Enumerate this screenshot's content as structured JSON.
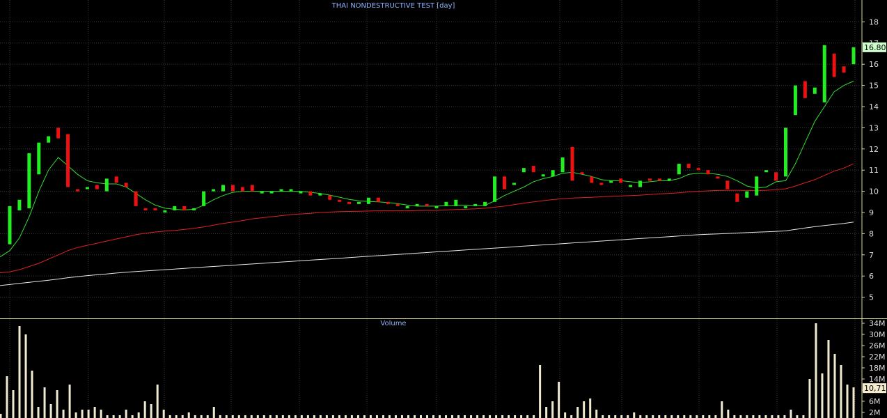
{
  "chart_data": [
    {
      "type": "candlestick",
      "title": "THAI NONDESTRUCTIVE TEST [day]",
      "ylim": [
        4,
        19
      ],
      "y_ticks": [
        "5",
        "6",
        "7",
        "8",
        "9",
        "10",
        "11",
        "12",
        "13",
        "14",
        "15",
        "16",
        "17",
        "18"
      ],
      "last_price_label": "16.80",
      "colors": {
        "up": "#22ee22",
        "down": "#ee1111",
        "ma_short": "#33dd33",
        "ma_mid": "#dd2222",
        "ma_long": "#e8e8e8",
        "grid": "#3a3a3a",
        "axis_text": "#dddddd",
        "price_tag": "#ccffcc"
      },
      "candles": [
        {
          "o": 7.5,
          "c": 9.3
        },
        {
          "o": 9.1,
          "c": 9.6
        },
        {
          "o": 9.2,
          "c": 11.8
        },
        {
          "o": 10.8,
          "c": 12.3
        },
        {
          "o": 12.3,
          "c": 12.6
        },
        {
          "o": 13.0,
          "c": 12.5
        },
        {
          "o": 12.7,
          "c": 10.2
        },
        {
          "o": 10.1,
          "c": 10.0
        },
        {
          "o": 10.1,
          "c": 10.2
        },
        {
          "o": 10.3,
          "c": 10.1
        },
        {
          "o": 10.0,
          "c": 10.6
        },
        {
          "o": 10.7,
          "c": 10.4
        },
        {
          "o": 10.4,
          "c": 10.2
        },
        {
          "o": 10.0,
          "c": 9.3
        },
        {
          "o": 9.2,
          "c": 9.1
        },
        {
          "o": 9.2,
          "c": 9.1
        },
        {
          "o": 9.1,
          "c": 9.1
        },
        {
          "o": 9.1,
          "c": 9.3
        },
        {
          "o": 9.3,
          "c": 9.1
        },
        {
          "o": 9.1,
          "c": 9.2
        },
        {
          "o": 9.3,
          "c": 10.0
        },
        {
          "o": 10.0,
          "c": 10.1
        },
        {
          "o": 10.0,
          "c": 10.3
        },
        {
          "o": 10.3,
          "c": 10.0
        },
        {
          "o": 10.2,
          "c": 10.0
        },
        {
          "o": 10.3,
          "c": 10.0
        },
        {
          "o": 10.0,
          "c": 10.0
        },
        {
          "o": 10.0,
          "c": 10.0
        },
        {
          "o": 10.0,
          "c": 10.1
        },
        {
          "o": 10.0,
          "c": 10.1
        },
        {
          "o": 10.0,
          "c": 10.0
        },
        {
          "o": 10.0,
          "c": 9.8
        },
        {
          "o": 9.9,
          "c": 9.9
        },
        {
          "o": 9.8,
          "c": 9.6
        },
        {
          "o": 9.6,
          "c": 9.5
        },
        {
          "o": 9.5,
          "c": 9.4
        },
        {
          "o": 9.4,
          "c": 9.5
        },
        {
          "o": 9.4,
          "c": 9.7
        },
        {
          "o": 9.7,
          "c": 9.5
        },
        {
          "o": 9.5,
          "c": 9.4
        },
        {
          "o": 9.4,
          "c": 9.3
        },
        {
          "o": 9.2,
          "c": 9.3
        },
        {
          "o": 9.3,
          "c": 9.4
        },
        {
          "o": 9.4,
          "c": 9.3
        },
        {
          "o": 9.3,
          "c": 9.3
        },
        {
          "o": 9.3,
          "c": 9.5
        },
        {
          "o": 9.3,
          "c": 9.6
        },
        {
          "o": 9.3,
          "c": 9.3
        },
        {
          "o": 9.3,
          "c": 9.4
        },
        {
          "o": 9.3,
          "c": 9.5
        },
        {
          "o": 9.5,
          "c": 10.7
        },
        {
          "o": 10.7,
          "c": 10.1
        },
        {
          "o": 10.3,
          "c": 10.4
        },
        {
          "o": 10.9,
          "c": 11.1
        },
        {
          "o": 11.2,
          "c": 10.9
        },
        {
          "o": 10.7,
          "c": 10.8
        },
        {
          "o": 10.7,
          "c": 11.0
        },
        {
          "o": 10.9,
          "c": 11.6
        },
        {
          "o": 12.1,
          "c": 10.5
        },
        {
          "o": 10.9,
          "c": 10.8
        },
        {
          "o": 10.7,
          "c": 10.4
        },
        {
          "o": 10.4,
          "c": 10.3
        },
        {
          "o": 10.4,
          "c": 10.5
        },
        {
          "o": 10.6,
          "c": 10.4
        },
        {
          "o": 10.3,
          "c": 10.3
        },
        {
          "o": 10.2,
          "c": 10.5
        },
        {
          "o": 10.6,
          "c": 10.5
        },
        {
          "o": 10.6,
          "c": 10.5
        },
        {
          "o": 10.5,
          "c": 10.6
        },
        {
          "o": 10.8,
          "c": 11.3
        },
        {
          "o": 11.3,
          "c": 11.1
        },
        {
          "o": 11.1,
          "c": 11.0
        },
        {
          "o": 11.0,
          "c": 10.8
        },
        {
          "o": 10.7,
          "c": 10.6
        },
        {
          "o": 10.5,
          "c": 10.1
        },
        {
          "o": 9.9,
          "c": 9.5
        },
        {
          "o": 9.7,
          "c": 10.0
        },
        {
          "o": 9.8,
          "c": 10.7
        },
        {
          "o": 11.0,
          "c": 11.0
        },
        {
          "o": 10.9,
          "c": 10.5
        },
        {
          "o": 10.7,
          "c": 13.0
        },
        {
          "o": 13.6,
          "c": 15.0
        },
        {
          "o": 15.2,
          "c": 14.4
        },
        {
          "o": 14.6,
          "c": 14.9
        },
        {
          "o": 14.2,
          "c": 16.9
        },
        {
          "o": 16.5,
          "c": 15.4
        },
        {
          "o": 15.9,
          "c": 15.6
        },
        {
          "o": 16.0,
          "c": 16.8
        }
      ],
      "ma_short": [
        7.2,
        7.8,
        8.8,
        10.0,
        11.0,
        11.6,
        11.2,
        10.8,
        10.5,
        10.4,
        10.35,
        10.35,
        10.2,
        9.9,
        9.6,
        9.35,
        9.2,
        9.15,
        9.12,
        9.15,
        9.35,
        9.6,
        9.8,
        9.95,
        10.0,
        10.0,
        10.0,
        10.0,
        10.0,
        10.0,
        10.0,
        9.95,
        9.9,
        9.82,
        9.72,
        9.62,
        9.55,
        9.52,
        9.5,
        9.47,
        9.42,
        9.35,
        9.3,
        9.3,
        9.3,
        9.32,
        9.35,
        9.35,
        9.33,
        9.34,
        9.55,
        9.8,
        10.0,
        10.2,
        10.45,
        10.6,
        10.7,
        10.85,
        10.9,
        10.8,
        10.7,
        10.55,
        10.5,
        10.5,
        10.45,
        10.4,
        10.45,
        10.5,
        10.5,
        10.6,
        10.8,
        10.85,
        10.85,
        10.8,
        10.7,
        10.5,
        10.25,
        10.15,
        10.2,
        10.45,
        10.5,
        11.3,
        12.3,
        13.3,
        14.0,
        14.7,
        15.0,
        15.2,
        15.6
      ],
      "ma_mid": [
        6.2,
        6.3,
        6.45,
        6.6,
        6.8,
        7.0,
        7.2,
        7.35,
        7.45,
        7.55,
        7.65,
        7.75,
        7.85,
        7.95,
        8.02,
        8.08,
        8.12,
        8.15,
        8.2,
        8.25,
        8.32,
        8.4,
        8.48,
        8.55,
        8.62,
        8.7,
        8.75,
        8.8,
        8.85,
        8.9,
        8.93,
        8.96,
        9.0,
        9.02,
        9.04,
        9.05,
        9.06,
        9.07,
        9.08,
        9.08,
        9.08,
        9.08,
        9.09,
        9.1,
        9.1,
        9.12,
        9.14,
        9.15,
        9.17,
        9.2,
        9.25,
        9.3,
        9.37,
        9.44,
        9.5,
        9.56,
        9.61,
        9.65,
        9.68,
        9.7,
        9.72,
        9.74,
        9.76,
        9.78,
        9.8,
        9.82,
        9.85,
        9.88,
        9.9,
        9.93,
        9.97,
        10.0,
        10.02,
        10.04,
        10.05,
        10.05,
        10.04,
        10.04,
        10.05,
        10.08,
        10.12,
        10.25,
        10.4,
        10.55,
        10.75,
        10.95,
        11.1,
        11.3,
        11.55
      ],
      "ma_long": [
        5.6,
        5.65,
        5.7,
        5.75,
        5.8,
        5.86,
        5.92,
        5.97,
        6.02,
        6.06,
        6.1,
        6.14,
        6.18,
        6.21,
        6.24,
        6.27,
        6.3,
        6.33,
        6.36,
        6.39,
        6.42,
        6.45,
        6.48,
        6.51,
        6.54,
        6.57,
        6.6,
        6.63,
        6.66,
        6.69,
        6.72,
        6.75,
        6.78,
        6.81,
        6.84,
        6.87,
        6.9,
        6.93,
        6.96,
        6.99,
        7.02,
        7.05,
        7.08,
        7.11,
        7.14,
        7.17,
        7.2,
        7.23,
        7.26,
        7.29,
        7.32,
        7.35,
        7.38,
        7.41,
        7.44,
        7.47,
        7.5,
        7.53,
        7.56,
        7.59,
        7.62,
        7.65,
        7.68,
        7.71,
        7.74,
        7.77,
        7.8,
        7.83,
        7.86,
        7.89,
        7.92,
        7.95,
        7.97,
        7.99,
        8.01,
        8.03,
        8.05,
        8.07,
        8.09,
        8.11,
        8.13,
        8.2,
        8.27,
        8.33,
        8.38,
        8.43,
        8.48,
        8.55,
        8.62
      ]
    },
    {
      "type": "bar",
      "title": "Volume",
      "ylim": [
        0,
        35
      ],
      "y_ticks": [
        "2M",
        "6M",
        "10M",
        "14M",
        "18M",
        "22M",
        "26M",
        "30M",
        "34M"
      ],
      "last_volume_label": "10,714",
      "colors": {
        "bar": "#f0ead0",
        "axis_text": "#dddddd",
        "volume_tag": "#f5ecd0"
      },
      "values_millions": [
        1.5,
        15,
        10,
        33,
        30,
        17,
        4,
        11,
        5,
        10,
        3,
        12,
        2,
        3,
        3,
        4,
        3,
        1,
        1,
        1,
        3,
        1,
        2,
        6,
        5,
        12,
        3,
        1,
        1,
        1,
        2,
        1,
        1,
        1,
        4,
        1,
        1,
        1,
        1,
        1,
        1,
        1,
        1,
        1,
        1,
        1,
        1,
        1,
        1,
        1,
        1,
        1,
        1,
        1,
        1,
        1,
        1,
        1,
        1,
        1,
        1,
        1,
        1,
        1,
        1,
        1,
        1,
        1,
        1,
        1,
        1,
        1,
        1,
        1,
        1,
        1,
        1,
        1,
        1,
        1,
        1,
        1,
        1,
        1,
        1,
        1,
        19,
        4,
        6,
        13,
        2,
        1,
        4,
        6,
        7,
        3,
        1,
        1,
        1,
        1,
        1,
        2,
        1,
        1,
        1,
        1,
        1,
        1,
        1,
        1,
        1,
        1,
        1,
        1,
        1,
        6,
        3,
        1,
        1,
        1,
        1,
        1,
        1,
        1,
        1,
        1,
        3,
        1,
        1,
        14,
        34,
        16,
        28,
        23,
        19,
        12,
        11
      ]
    }
  ]
}
